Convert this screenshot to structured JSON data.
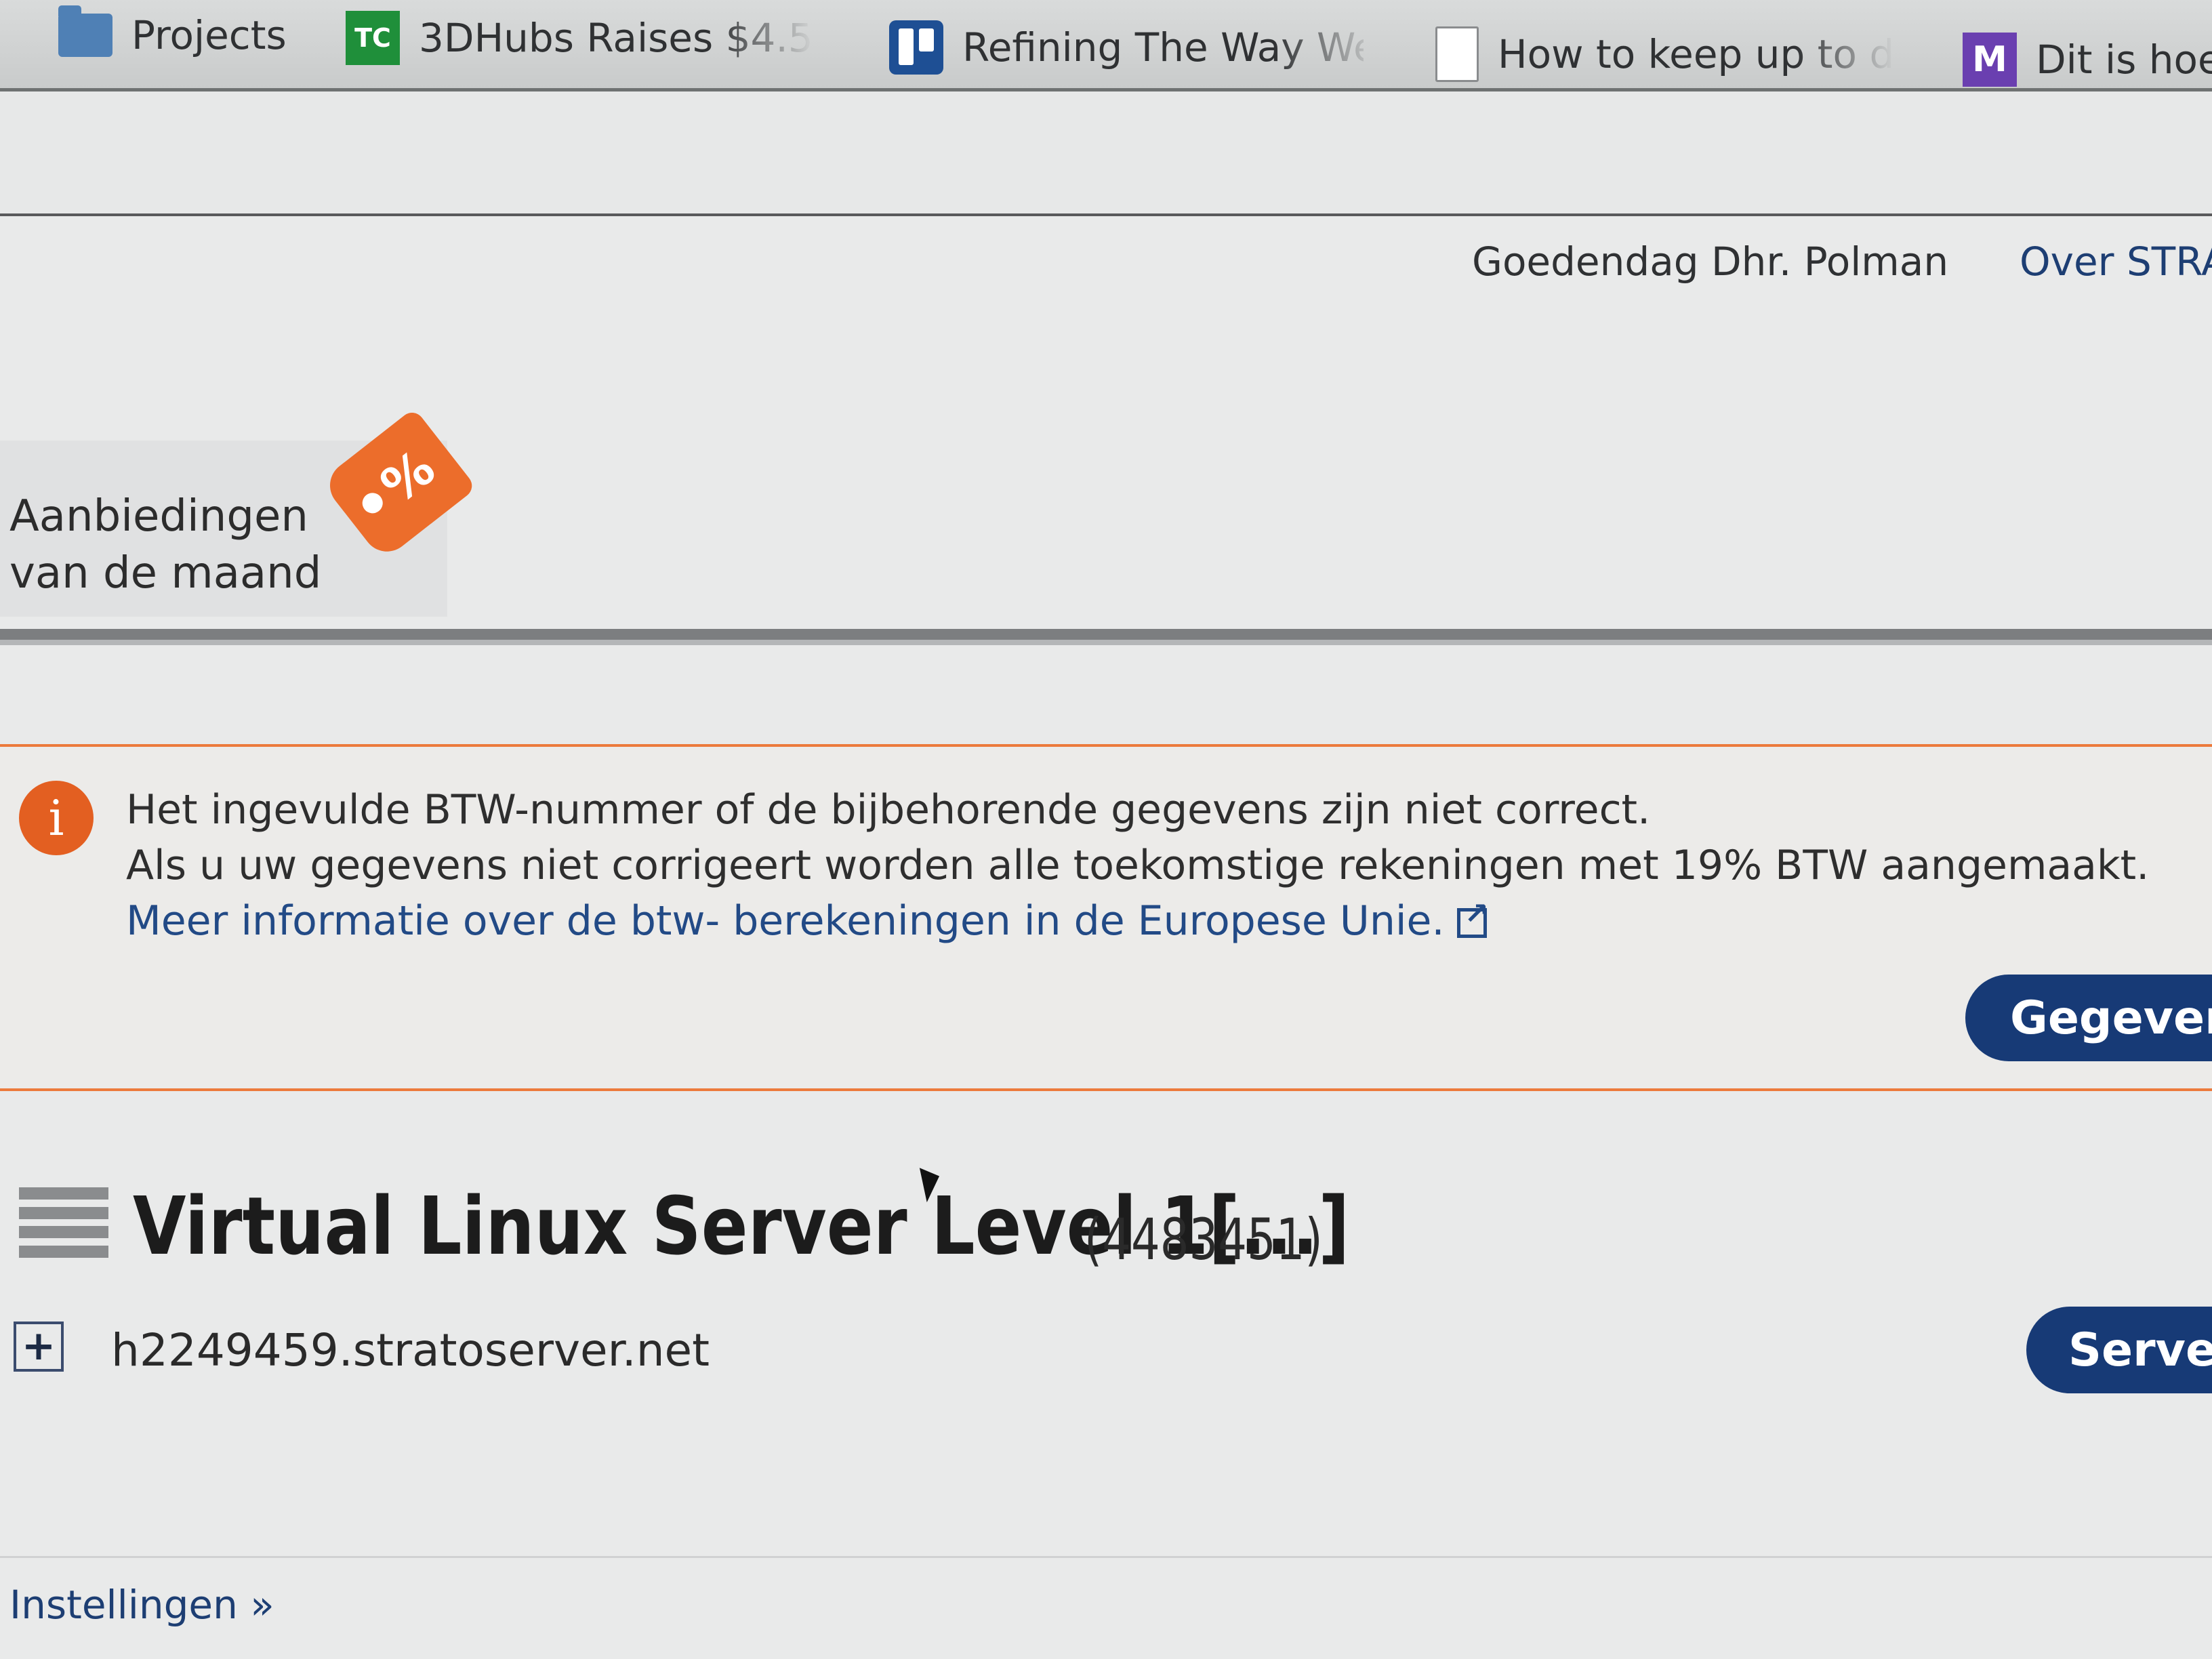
{
  "bookmarks": [
    {
      "label": "Projects",
      "icon": "folder-icon"
    },
    {
      "label": "3DHubs Raises $4.5",
      "icon": "techcrunch-icon",
      "icon_text": "TC"
    },
    {
      "label": "Refining The Way We",
      "icon": "trello-icon"
    },
    {
      "label": "How to keep up to d",
      "icon": "document-icon"
    },
    {
      "label": "Dit is hoe",
      "icon": "medium-icon",
      "icon_text": "M"
    }
  ],
  "header": {
    "greeting": "Goedendag Dhr. Polman",
    "about_link": "Over STRA"
  },
  "offers": {
    "line1": "Aanbiedingen",
    "line2": "van de maand",
    "tag_symbol": "%"
  },
  "alert": {
    "icon_text": "i",
    "line1": "Het ingevulde BTW-nummer of de bijbehorende gegevens zijn niet correct.",
    "line2": "Als u uw gegevens niet corrigeert worden alle toekomstige rekeningen met 19% BTW aangemaakt.",
    "link": "Meer informatie over de btw- berekeningen in de Europese Unie.",
    "button": "Gegeven"
  },
  "server": {
    "title": "Virtual Linux Server Level 1[...]",
    "id": "(4483451)",
    "hostname": "h2249459.stratoserver.net",
    "expand_symbol": "+",
    "button": "Server"
  },
  "footer": {
    "settings_link": "Instellingen »"
  },
  "colors": {
    "accent_orange": "#ec6d2b",
    "button_navy": "#173a76",
    "link_blue": "#224a86"
  }
}
